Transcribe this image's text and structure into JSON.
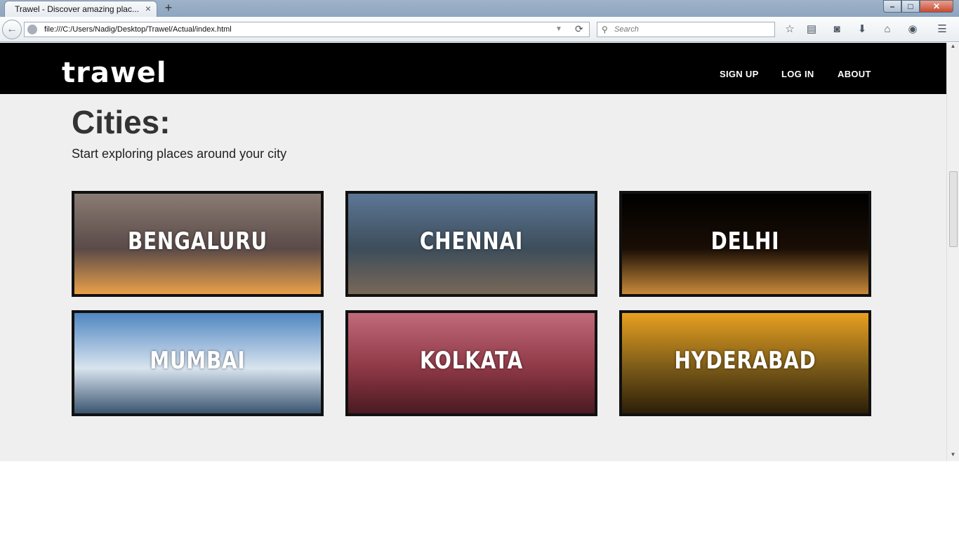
{
  "browser": {
    "tab_title": "Trawel - Discover amazing plac...",
    "tab_close": "×",
    "new_tab": "+",
    "url": "file:///C:/Users/Nadig/Desktop/Trawel/Actual/index.html",
    "search_placeholder": "Search",
    "min_glyph": "–",
    "max_glyph": "□",
    "close_glyph": "✕",
    "back_glyph": "←",
    "reload_glyph": "⟳",
    "dropdown_glyph": "▼",
    "search_glyph": "⚲",
    "toolbar_icons": [
      "star-icon",
      "reading-list-icon",
      "pocket-icon",
      "download-icon",
      "home-icon",
      "chat-icon",
      "menu-icon"
    ],
    "toolbar_glyphs": [
      "☆",
      "▤",
      "◙",
      "⬇",
      "⌂",
      "◉",
      "☰"
    ]
  },
  "site": {
    "logo": "trawel",
    "nav": [
      {
        "label": "SIGN UP"
      },
      {
        "label": "LOG IN"
      },
      {
        "label": "ABOUT"
      }
    ],
    "heading": "Cities:",
    "subtitle": "Start exploring places around your city",
    "cities": [
      {
        "name": "BENGALURU",
        "colors": [
          "#8a7b73",
          "#5a4a48",
          "#e9a04a"
        ]
      },
      {
        "name": "CHENNAI",
        "colors": [
          "#5c7796",
          "#3d4d5a",
          "#786858"
        ]
      },
      {
        "name": "DELHI",
        "colors": [
          "#000000",
          "#1a0e05",
          "#c98a3a"
        ]
      },
      {
        "name": "MUMBAI",
        "colors": [
          "#4f86c1",
          "#d9e4ef",
          "#3a5570"
        ]
      },
      {
        "name": "KOLKATA",
        "colors": [
          "#c06a7a",
          "#8e3846",
          "#4a1a22"
        ]
      },
      {
        "name": "HYDERABAD",
        "colors": [
          "#e8a020",
          "#7a5a18",
          "#2c1e08"
        ]
      }
    ]
  },
  "scrollbar": {
    "up": "▲",
    "down": "▼"
  }
}
